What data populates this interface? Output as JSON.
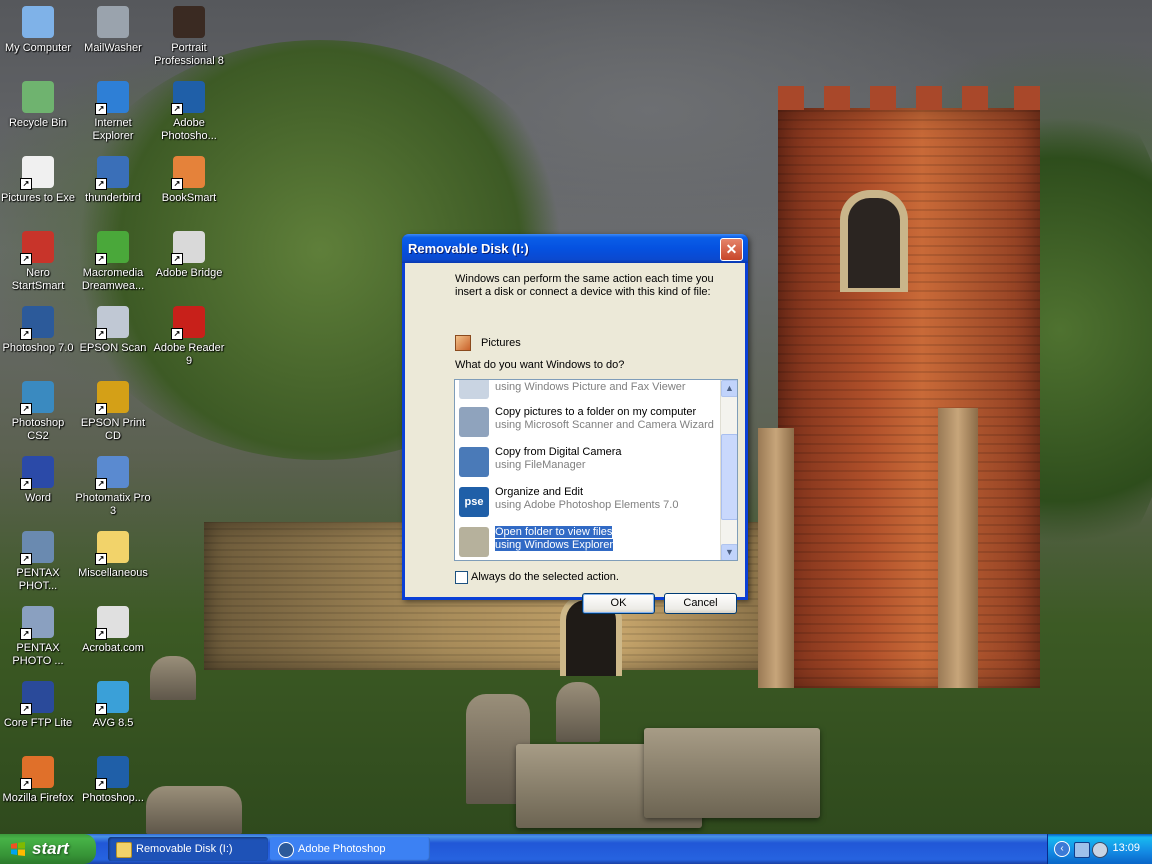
{
  "desktop_icons": [
    {
      "id": "my-computer",
      "label": "My Computer",
      "icon": "computer-icon",
      "color": "#7fb2e8"
    },
    {
      "id": "mailwasher",
      "label": "MailWasher",
      "icon": "mailwasher-icon",
      "color": "#9aa3ad"
    },
    {
      "id": "portrait-professional",
      "label": "Portrait Professional 8",
      "icon": "portrait-professional-icon",
      "color": "#3a2a22"
    },
    {
      "id": "recycle-bin",
      "label": "Recycle Bin",
      "icon": "recycle-bin-icon",
      "color": "#6fb36f"
    },
    {
      "id": "internet-explorer",
      "label": "Internet Explorer",
      "icon": "internet-explorer-icon",
      "color": "#2e7fd6"
    },
    {
      "id": "adobe-photoshop-elements",
      "label": "Adobe Photosho...",
      "icon": "pse-icon",
      "color": "#1f5fa8"
    },
    {
      "id": "pictures-to-exe",
      "label": "Pictures to Exe",
      "icon": "pictures-to-exe-icon",
      "color": "#f0f0f0"
    },
    {
      "id": "thunderbird",
      "label": "thunderbird",
      "icon": "thunderbird-icon",
      "color": "#3a6fb8"
    },
    {
      "id": "booksmart",
      "label": "BookSmart",
      "icon": "booksmart-icon",
      "color": "#e5823a"
    },
    {
      "id": "nero-startsmart",
      "label": "Nero StartSmart",
      "icon": "nero-icon",
      "color": "#c8342a"
    },
    {
      "id": "macromedia-dreamweaver",
      "label": "Macromedia Dreamwea...",
      "icon": "dreamweaver-icon",
      "color": "#4aa83a"
    },
    {
      "id": "adobe-bridge",
      "label": "Adobe Bridge",
      "icon": "adobe-bridge-icon",
      "color": "#d9d9d9"
    },
    {
      "id": "photoshop-7",
      "label": "Photoshop 7.0",
      "icon": "photoshop-icon",
      "color": "#2c5a9a"
    },
    {
      "id": "epson-scan",
      "label": "EPSON Scan",
      "icon": "epson-scan-icon",
      "color": "#c0c8d4"
    },
    {
      "id": "adobe-reader",
      "label": "Adobe Reader 9",
      "icon": "adobe-reader-icon",
      "color": "#c8201a"
    },
    {
      "id": "photoshop-cs2",
      "label": "Photoshop CS2",
      "icon": "photoshop-cs2-icon",
      "color": "#3a8ac0"
    },
    {
      "id": "epson-print-cd",
      "label": "EPSON Print CD",
      "icon": "epson-print-cd-icon",
      "color": "#d4a017"
    },
    {
      "id": "word",
      "label": "Word",
      "icon": "word-icon",
      "color": "#2b4aa8"
    },
    {
      "id": "photomatix",
      "label": "Photomatix Pro 3",
      "icon": "photomatix-icon",
      "color": "#5a8ad0"
    },
    {
      "id": "pentax-photo-1",
      "label": "PENTAX PHOT...",
      "icon": "pentax-icon",
      "color": "#6a8ab0"
    },
    {
      "id": "miscellaneous",
      "label": "Miscellaneous",
      "icon": "folder-icon",
      "color": "#f2d36a"
    },
    {
      "id": "pentax-photo-2",
      "label": "PENTAX PHOTO ...",
      "icon": "pentax-icon",
      "color": "#8aa0c0"
    },
    {
      "id": "acrobat-com",
      "label": "Acrobat.com",
      "icon": "acrobat-icon",
      "color": "#e0e0e0"
    },
    {
      "id": "core-ftp-lite",
      "label": "Core FTP Lite",
      "icon": "core-ftp-icon",
      "color": "#2a4a9a"
    },
    {
      "id": "avg",
      "label": "AVG 8.5",
      "icon": "avg-icon",
      "color": "#3aa0d8"
    },
    {
      "id": "firefox",
      "label": "Mozilla Firefox",
      "icon": "firefox-icon",
      "color": "#e0702a"
    },
    {
      "id": "photoshop-elements",
      "label": "Photoshop...",
      "icon": "pse-icon",
      "color": "#1f5fa8"
    }
  ],
  "dialog": {
    "title": "Removable Disk (I:)",
    "intro": "Windows can perform the same action each time you insert a disk or connect a device with this kind of file:",
    "content_type": "Pictures",
    "question": "What do you want Windows to do?",
    "actions": [
      {
        "title": "",
        "subtitle": "using Windows Picture and Fax Viewer",
        "icon": "fax-viewer-icon",
        "selected": false
      },
      {
        "title": "Copy pictures to a folder on my computer",
        "subtitle": "using Microsoft Scanner and Camera Wizard",
        "icon": "scanner-wizard-icon",
        "selected": false
      },
      {
        "title": "Copy from Digital Camera",
        "subtitle": "using FileManager",
        "icon": "filemanager-icon",
        "selected": false
      },
      {
        "title": "Organize and Edit",
        "subtitle": "using Adobe Photoshop Elements 7.0",
        "icon": "pse-icon",
        "selected": false
      },
      {
        "title": "Open folder to view files",
        "subtitle": "using Windows Explorer",
        "icon": "folder-icon",
        "selected": true
      }
    ],
    "always_checkbox": "Always do the selected action.",
    "always_checked": false,
    "ok_label": "OK",
    "cancel_label": "Cancel",
    "close_glyph": "✕"
  },
  "taskbar": {
    "start_label": "start",
    "tasks": [
      {
        "label": "Removable Disk (I:)",
        "icon": "folder-icon"
      },
      {
        "label": "Adobe Photoshop",
        "icon": "photoshop-icon"
      }
    ],
    "clock": "13:09",
    "tray_chevron": "‹"
  },
  "colors": {
    "dialog_border": "#0a3fd6",
    "selection": "#316ac5",
    "taskbar": "#2459d3",
    "start_green": "#3c9a3c"
  }
}
